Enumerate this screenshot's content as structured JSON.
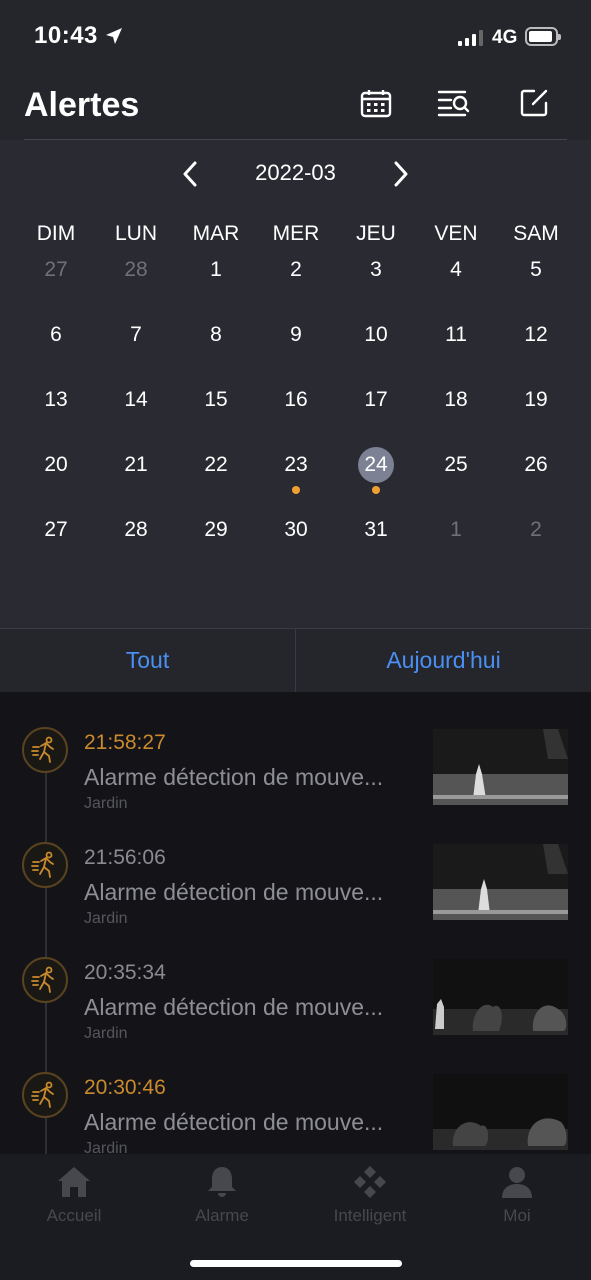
{
  "status_bar": {
    "time": "10:43",
    "network": "4G"
  },
  "header": {
    "title": "Alertes"
  },
  "calendar": {
    "month": "2022-03",
    "weekdays": [
      "DIM",
      "LUN",
      "MAR",
      "MER",
      "JEU",
      "VEN",
      "SAM"
    ],
    "days": [
      {
        "label": "27",
        "muted": true
      },
      {
        "label": "28",
        "muted": true
      },
      {
        "label": "1"
      },
      {
        "label": "2"
      },
      {
        "label": "3"
      },
      {
        "label": "4"
      },
      {
        "label": "5"
      },
      {
        "label": "6"
      },
      {
        "label": "7"
      },
      {
        "label": "8"
      },
      {
        "label": "9"
      },
      {
        "label": "10"
      },
      {
        "label": "11"
      },
      {
        "label": "12"
      },
      {
        "label": "13"
      },
      {
        "label": "14"
      },
      {
        "label": "15"
      },
      {
        "label": "16"
      },
      {
        "label": "17"
      },
      {
        "label": "18"
      },
      {
        "label": "19"
      },
      {
        "label": "20"
      },
      {
        "label": "21"
      },
      {
        "label": "22"
      },
      {
        "label": "23",
        "has_alert": true
      },
      {
        "label": "24",
        "selected": true,
        "has_alert": true
      },
      {
        "label": "25"
      },
      {
        "label": "26"
      },
      {
        "label": "27"
      },
      {
        "label": "28"
      },
      {
        "label": "29"
      },
      {
        "label": "30"
      },
      {
        "label": "31"
      },
      {
        "label": "1",
        "muted": true
      },
      {
        "label": "2",
        "muted": true
      }
    ]
  },
  "filters": {
    "all_label": "Tout",
    "today_label": "Aujourd'hui"
  },
  "alerts": [
    {
      "time": "21:58:27",
      "unread": true,
      "description": "Alarme détection de mouve...",
      "location": "Jardin"
    },
    {
      "time": "21:56:06",
      "unread": false,
      "description": "Alarme détection de mouve...",
      "location": "Jardin"
    },
    {
      "time": "20:35:34",
      "unread": false,
      "description": "Alarme détection de mouve...",
      "location": "Jardin"
    },
    {
      "time": "20:30:46",
      "unread": true,
      "description": "Alarme détection de mouve...",
      "location": "Jardin"
    }
  ],
  "tabbar": {
    "items": [
      {
        "label": "Accueil",
        "icon": "home-icon"
      },
      {
        "label": "Alarme",
        "icon": "bell-icon"
      },
      {
        "label": "Intelligent",
        "icon": "diamond-grid-icon"
      },
      {
        "label": "Moi",
        "icon": "person-icon"
      }
    ]
  },
  "colors": {
    "accent": "#4a8ff2",
    "alert_orange": "#f0a030",
    "unread_time": "#c98a2e"
  }
}
